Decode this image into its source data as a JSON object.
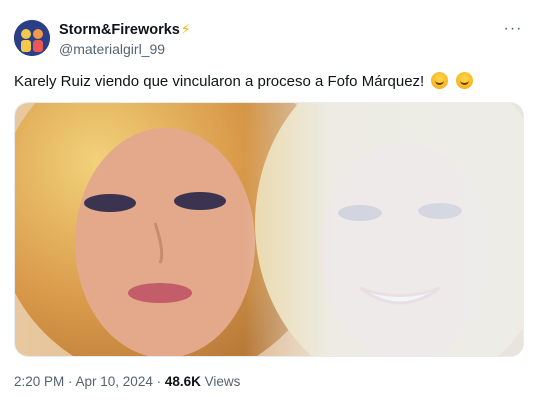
{
  "author": {
    "display_name": "Storm&Fireworks",
    "verified_badge_icon": "lightning-bolt-icon",
    "handle": "@materialgirl_99"
  },
  "more_icon": "ellipsis-icon",
  "tweet": {
    "text": "Karely Ruiz viendo que vincularon a proceso a Fofo Márquez!",
    "emojis": [
      "face-with-hand-over-mouth-emoji",
      "grinning-squinting-face-emoji"
    ]
  },
  "media": {
    "type": "photo",
    "description_icon": "meme-photo"
  },
  "meta": {
    "timestamp": "2:20 PM · Apr 10, 2024",
    "separator": " · ",
    "views_count": "48.6K",
    "views_label": "Views"
  },
  "colors": {
    "text_primary": "#0f1419",
    "text_secondary": "#536471",
    "bolt": "#f5b400"
  }
}
